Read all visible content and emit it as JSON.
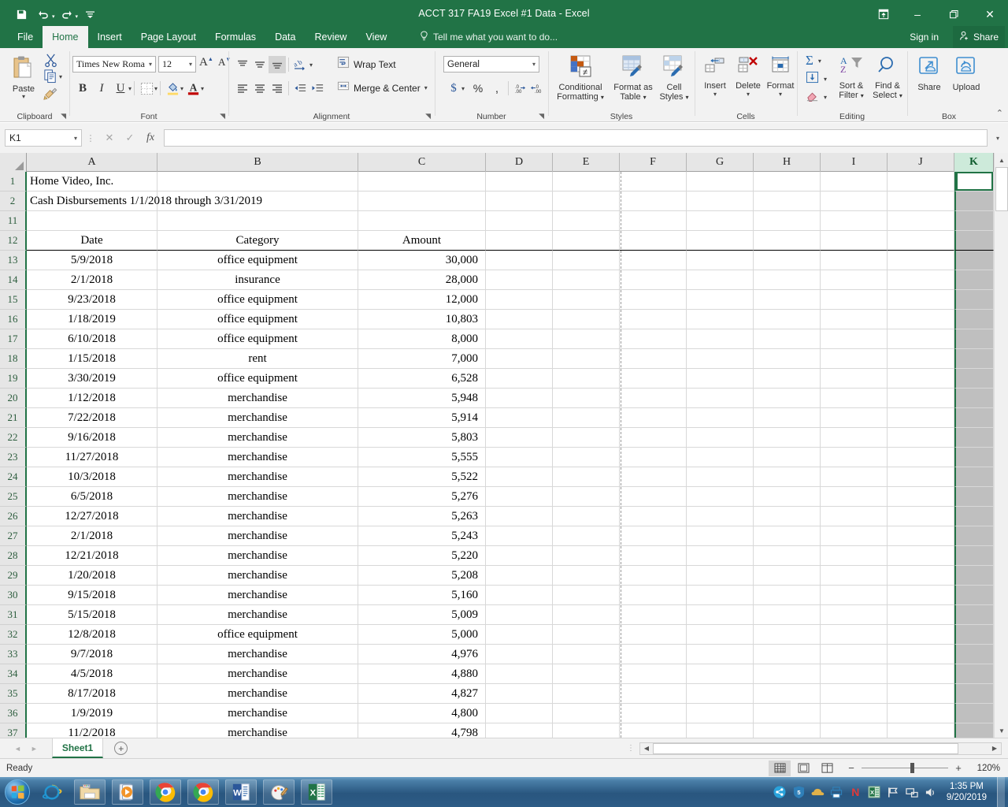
{
  "window": {
    "title": "ACCT 317 FA19 Excel #1 Data - Excel",
    "qat": [
      {
        "name": "save",
        "glyph": "💾"
      },
      {
        "name": "undo",
        "glyph": "↶"
      },
      {
        "name": "redo",
        "glyph": "↷"
      },
      {
        "name": "customize-qat",
        "glyph": "≡"
      }
    ],
    "controls": {
      "ribbon_display_options": "⬜",
      "minimize": "–",
      "restore": "❐",
      "close": "✕"
    }
  },
  "ribbon": {
    "tabs": [
      "File",
      "Home",
      "Insert",
      "Page Layout",
      "Formulas",
      "Data",
      "Review",
      "View"
    ],
    "active_tab": "Home",
    "tellme_placeholder": "Tell me what you want to do...",
    "sign_in": "Sign in",
    "share": "Share",
    "groups": {
      "clipboard": {
        "label": "Clipboard",
        "paste": "Paste",
        "cut": "Cut",
        "copy": "Copy",
        "format_painter": "Format Painter"
      },
      "font": {
        "label": "Font",
        "font_name": "Times New Roma",
        "font_size": "12",
        "grow_font": "A",
        "shrink_font": "A",
        "bold": "B",
        "italic": "I",
        "underline": "U",
        "borders": "Borders",
        "fill_color": "Fill Color",
        "font_color": "A"
      },
      "alignment": {
        "label": "Alignment",
        "wrap_text": "Wrap Text",
        "merge_center": "Merge & Center",
        "orientation": "Orientation",
        "decrease_indent": "Decrease Indent",
        "increase_indent": "Increase Indent"
      },
      "number": {
        "label": "Number",
        "format": "General",
        "accounting": "$",
        "percent": "%",
        "comma": ",",
        "increase_decimal": ".00",
        "decrease_decimal": ".00"
      },
      "styles": {
        "label": "Styles",
        "conditional_formatting": "Conditional\nFormatting",
        "conditional_formatting_l1": "Conditional",
        "conditional_formatting_l2": "Formatting",
        "format_as_table_l1": "Format as",
        "format_as_table_l2": "Table",
        "cell_styles_l1": "Cell",
        "cell_styles_l2": "Styles"
      },
      "cells": {
        "label": "Cells",
        "insert": "Insert",
        "delete": "Delete",
        "format": "Format"
      },
      "editing": {
        "label": "Editing",
        "autosum": "Σ",
        "fill": "Fill",
        "clear": "Clear",
        "sort_filter_l1": "Sort &",
        "sort_filter_l2": "Filter",
        "find_select_l1": "Find &",
        "find_select_l2": "Select"
      },
      "box": {
        "label": "Box",
        "share": "Share",
        "upload": "Upload"
      }
    },
    "collapse_ribbon": "⌃"
  },
  "formula_bar": {
    "name_box": "K1",
    "cancel": "✕",
    "enter": "✓",
    "insert_function": "fx",
    "value": ""
  },
  "grid": {
    "columns": [
      "A",
      "B",
      "C",
      "D",
      "E",
      "F",
      "G",
      "H",
      "I",
      "J",
      "K"
    ],
    "selected_column": "K",
    "active_cell": "K1",
    "rows": [
      {
        "num": "1",
        "a": "Home Video, Inc.",
        "b": "",
        "c": "",
        "style": "title"
      },
      {
        "num": "2",
        "a": "Cash Disbursements 1/1/2018 through 3/31/2019",
        "b": "",
        "c": "",
        "style": "title"
      },
      {
        "num": "11",
        "a": "",
        "b": "",
        "c": "",
        "style": "blank"
      },
      {
        "num": "12",
        "a": "Date",
        "b": "Category",
        "c": "Amount",
        "style": "header"
      },
      {
        "num": "13",
        "a": "5/9/2018",
        "b": "office equipment",
        "c": "30,000"
      },
      {
        "num": "14",
        "a": "2/1/2018",
        "b": "insurance",
        "c": "28,000"
      },
      {
        "num": "15",
        "a": "9/23/2018",
        "b": "office equipment",
        "c": "12,000"
      },
      {
        "num": "16",
        "a": "1/18/2019",
        "b": "office equipment",
        "c": "10,803"
      },
      {
        "num": "17",
        "a": "6/10/2018",
        "b": "office equipment",
        "c": "8,000"
      },
      {
        "num": "18",
        "a": "1/15/2018",
        "b": "rent",
        "c": "7,000"
      },
      {
        "num": "19",
        "a": "3/30/2019",
        "b": "office equipment",
        "c": "6,528"
      },
      {
        "num": "20",
        "a": "1/12/2018",
        "b": "merchandise",
        "c": "5,948"
      },
      {
        "num": "21",
        "a": "7/22/2018",
        "b": "merchandise",
        "c": "5,914"
      },
      {
        "num": "22",
        "a": "9/16/2018",
        "b": "merchandise",
        "c": "5,803"
      },
      {
        "num": "23",
        "a": "11/27/2018",
        "b": "merchandise",
        "c": "5,555"
      },
      {
        "num": "24",
        "a": "10/3/2018",
        "b": "merchandise",
        "c": "5,522"
      },
      {
        "num": "25",
        "a": "6/5/2018",
        "b": "merchandise",
        "c": "5,276"
      },
      {
        "num": "26",
        "a": "12/27/2018",
        "b": "merchandise",
        "c": "5,263"
      },
      {
        "num": "27",
        "a": "2/1/2018",
        "b": "merchandise",
        "c": "5,243"
      },
      {
        "num": "28",
        "a": "12/21/2018",
        "b": "merchandise",
        "c": "5,220"
      },
      {
        "num": "29",
        "a": "1/20/2018",
        "b": "merchandise",
        "c": "5,208"
      },
      {
        "num": "30",
        "a": "9/15/2018",
        "b": "merchandise",
        "c": "5,160"
      },
      {
        "num": "31",
        "a": "5/15/2018",
        "b": "merchandise",
        "c": "5,009"
      },
      {
        "num": "32",
        "a": "12/8/2018",
        "b": "office equipment",
        "c": "5,000"
      },
      {
        "num": "33",
        "a": "9/7/2018",
        "b": "merchandise",
        "c": "4,976"
      },
      {
        "num": "34",
        "a": "4/5/2018",
        "b": "merchandise",
        "c": "4,880"
      },
      {
        "num": "35",
        "a": "8/17/2018",
        "b": "merchandise",
        "c": "4,827"
      },
      {
        "num": "36",
        "a": "1/9/2019",
        "b": "merchandise",
        "c": "4,800"
      },
      {
        "num": "37",
        "a": "11/2/2018",
        "b": "merchandise",
        "c": "4,798"
      }
    ]
  },
  "sheet_bar": {
    "prev": "◄",
    "next": "►",
    "tabs": [
      "Sheet1"
    ],
    "active_tab": "Sheet1",
    "new_sheet": "+"
  },
  "status_bar": {
    "status": "Ready",
    "views": [
      "normal-view",
      "page-layout-view",
      "page-break-preview"
    ],
    "active_view": "normal-view",
    "zoom_out": "−",
    "zoom_in": "+",
    "zoom_level": "120%"
  },
  "taskbar": {
    "start": "start-orb",
    "items": [
      {
        "name": "internet-explorer",
        "label": "Internet Explorer"
      },
      {
        "name": "file-explorer",
        "label": "File Explorer"
      },
      {
        "name": "windows-media-player",
        "label": "Windows Media Player"
      },
      {
        "name": "google-chrome",
        "label": "Google Chrome"
      },
      {
        "name": "google-chrome-2",
        "label": "Google Chrome"
      },
      {
        "name": "microsoft-word",
        "label": "Microsoft Word"
      },
      {
        "name": "paint",
        "label": "Paint"
      },
      {
        "name": "microsoft-excel",
        "label": "Microsoft Excel"
      }
    ],
    "tray": [
      "share-tray-icon",
      "html5-shield-icon",
      "cloud-icon",
      "printer-icon",
      "n-icon",
      "excel-tray-icon",
      "flag-icon",
      "network-icon",
      "volume-icon"
    ],
    "clock_time": "1:35 PM",
    "clock_date": "9/20/2019"
  },
  "colors": {
    "excel_green": "#217346",
    "ribbon_bg": "#f2f2f2",
    "selection_green": "#cdeada",
    "selected_col_fill": "#bfbfbf"
  }
}
